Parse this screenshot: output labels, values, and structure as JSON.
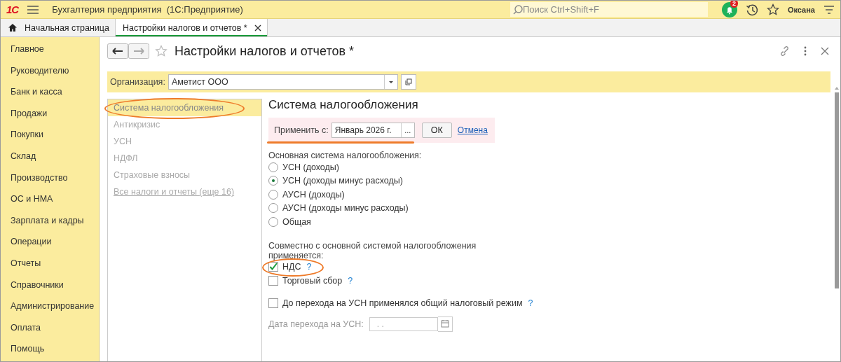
{
  "app_bar": {
    "logo": "1С",
    "title": "Бухгалтерия предприятия  (1С:Предприятие)",
    "search": {
      "placeholder": "Поиск Ctrl+Shift+F"
    },
    "notifications": "2",
    "user": "Оксана"
  },
  "tabs": [
    {
      "label": "Начальная страница",
      "kind": "home",
      "selected": false
    },
    {
      "label": "Настройки налогов и отчетов *",
      "kind": "doc",
      "selected": true
    }
  ],
  "sidebar": {
    "items": [
      {
        "label": "Главное"
      },
      {
        "label": "Руководителю"
      },
      {
        "label": "Банк и касса"
      },
      {
        "label": "Продажи"
      },
      {
        "label": "Покупки"
      },
      {
        "label": "Склад"
      },
      {
        "label": "Производство"
      },
      {
        "label": "ОС и НМА"
      },
      {
        "label": "Зарплата и кадры"
      },
      {
        "label": "Операции"
      },
      {
        "label": "Отчеты"
      },
      {
        "label": "Справочники"
      },
      {
        "label": "Администрирование"
      },
      {
        "label": "Оплата"
      },
      {
        "label": "Помощь"
      }
    ]
  },
  "form": {
    "title": "Настройки налогов и отчетов *",
    "organization": {
      "label": "Организация:",
      "value": "Аметист ООО"
    },
    "sections": [
      {
        "label": "Система налогообложения",
        "selected": true,
        "highlighted": true
      },
      {
        "label": "Антикризис",
        "selected": false,
        "highlighted": false
      },
      {
        "label": "УСН",
        "selected": false,
        "highlighted": false
      },
      {
        "label": "НДФЛ",
        "selected": false,
        "highlighted": false
      },
      {
        "label": "Страховые взносы",
        "selected": false,
        "highlighted": false
      }
    ],
    "sections_link": "Все налоги и отчеты (еще 16)",
    "panel": {
      "title": "Система налогообложения",
      "apply": {
        "label": "Применить с:",
        "value": "Январь 2026 г.",
        "picker": "...",
        "ok": "ОК",
        "cancel": "Отмена",
        "underlined": true
      },
      "main_system_label": "Основная система налогообложения:",
      "systems": [
        {
          "label": "УСН (доходы)",
          "selected": false
        },
        {
          "label": "УСН (доходы минус расходы)",
          "selected": true
        },
        {
          "label": "АУСН (доходы)",
          "selected": false
        },
        {
          "label": "АУСН (доходы минус расходы)",
          "selected": false
        },
        {
          "label": "Общая",
          "selected": false
        }
      ],
      "combined_label": "Совместно с основной системой налогообложения применяется:",
      "combined": [
        {
          "label": "НДС",
          "help": "?",
          "checked": true,
          "highlighted": true
        },
        {
          "label": "Торговый сбор",
          "help": "?",
          "checked": false,
          "highlighted": false
        }
      ],
      "prior_regime": {
        "label": "До перехода на УСН применялся общий налоговый режим",
        "help": "?",
        "checked": false
      },
      "transition_date": {
        "label": "Дата перехода на УСН:",
        "placeholder": ". ."
      }
    }
  }
}
